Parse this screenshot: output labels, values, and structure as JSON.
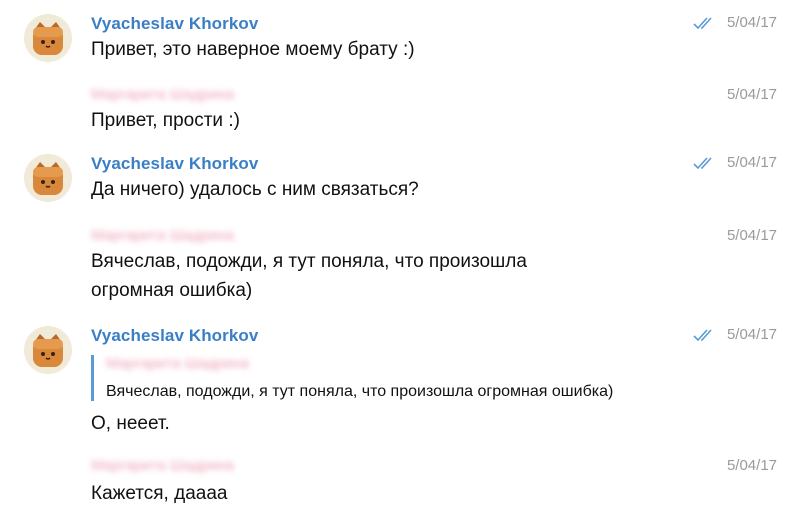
{
  "messages": [
    {
      "sender": "Vyacheslav Khorkov",
      "time": "5/04/17",
      "read": true,
      "text": "Привет, это наверное моему брату :)"
    },
    {
      "sender": "Маргарита Шадрина",
      "time": "5/04/17",
      "read": false,
      "text": "Привет, прости :)"
    },
    {
      "sender": "Vyacheslav Khorkov",
      "time": "5/04/17",
      "read": true,
      "text": "Да ничего) удалось с ним связаться?"
    },
    {
      "sender": "Маргарита Шадрина",
      "time": "5/04/17",
      "read": false,
      "text_line1": "Вячеслав, подожди, я тут поняла, что произошла",
      "text_line2": "огромная ошибка)"
    },
    {
      "sender": "Vyacheslav Khorkov",
      "time": "5/04/17",
      "read": true,
      "reply": {
        "sender": "Маргарита Шадрина",
        "text": "Вячеслав, подожди, я тут поняла, что произошла огромная ошибка)"
      },
      "text": "О, нееет."
    },
    {
      "sender": "Маргарита Шадрина",
      "time": "5/04/17",
      "read": false,
      "text": "Кажется, даааа"
    }
  ],
  "colors": {
    "sender_blue": "#3a7fc5",
    "check_blue": "#5a9ad6",
    "time_gray": "#9a9a9a"
  },
  "icons": {
    "avatar": "cat-avatar-icon",
    "read": "double-check-icon"
  }
}
